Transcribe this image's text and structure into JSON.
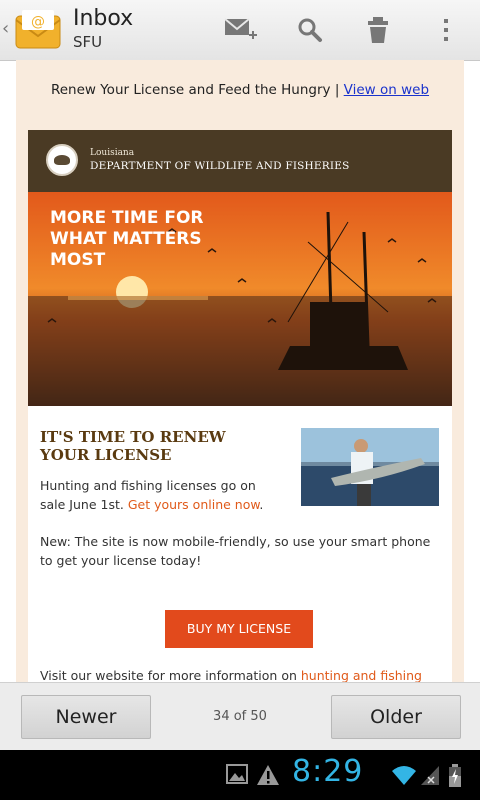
{
  "actionbar": {
    "title": "Inbox",
    "account": "SFU",
    "icons": [
      "compose-icon",
      "search-icon",
      "trash-icon",
      "overflow-menu-icon"
    ]
  },
  "email": {
    "preheader": "Renew Your License and Feed the Hungry | ",
    "view_on_web": "View on web",
    "dept_small": "Louisiana",
    "dept_name": "DEPARTMENT OF WILDLIFE AND FISHERIES",
    "hero_text": "MORE TIME FOR WHAT MATTERS MOST",
    "heading": "IT'S TIME TO RENEW YOUR LICENSE",
    "body1_text": "Hunting and fishing licenses go on sale June 1st. ",
    "body1_link": "Get yours online now",
    "body1_tail": ".",
    "body2": "New: The site is now mobile-friendly, so use your smart phone to get your license today!",
    "button_label": "BUY MY LICENSE",
    "body3_text": "Visit our website for more information on ",
    "body3_link": "hunting and fishing"
  },
  "nav": {
    "newer": "Newer",
    "older": "Older",
    "position": "34 of 50"
  },
  "status": {
    "time": "8:29",
    "colors": {
      "clock": "#33b5e5",
      "accent_orange": "#e24a1c",
      "link_blue": "#1a33cc"
    }
  }
}
